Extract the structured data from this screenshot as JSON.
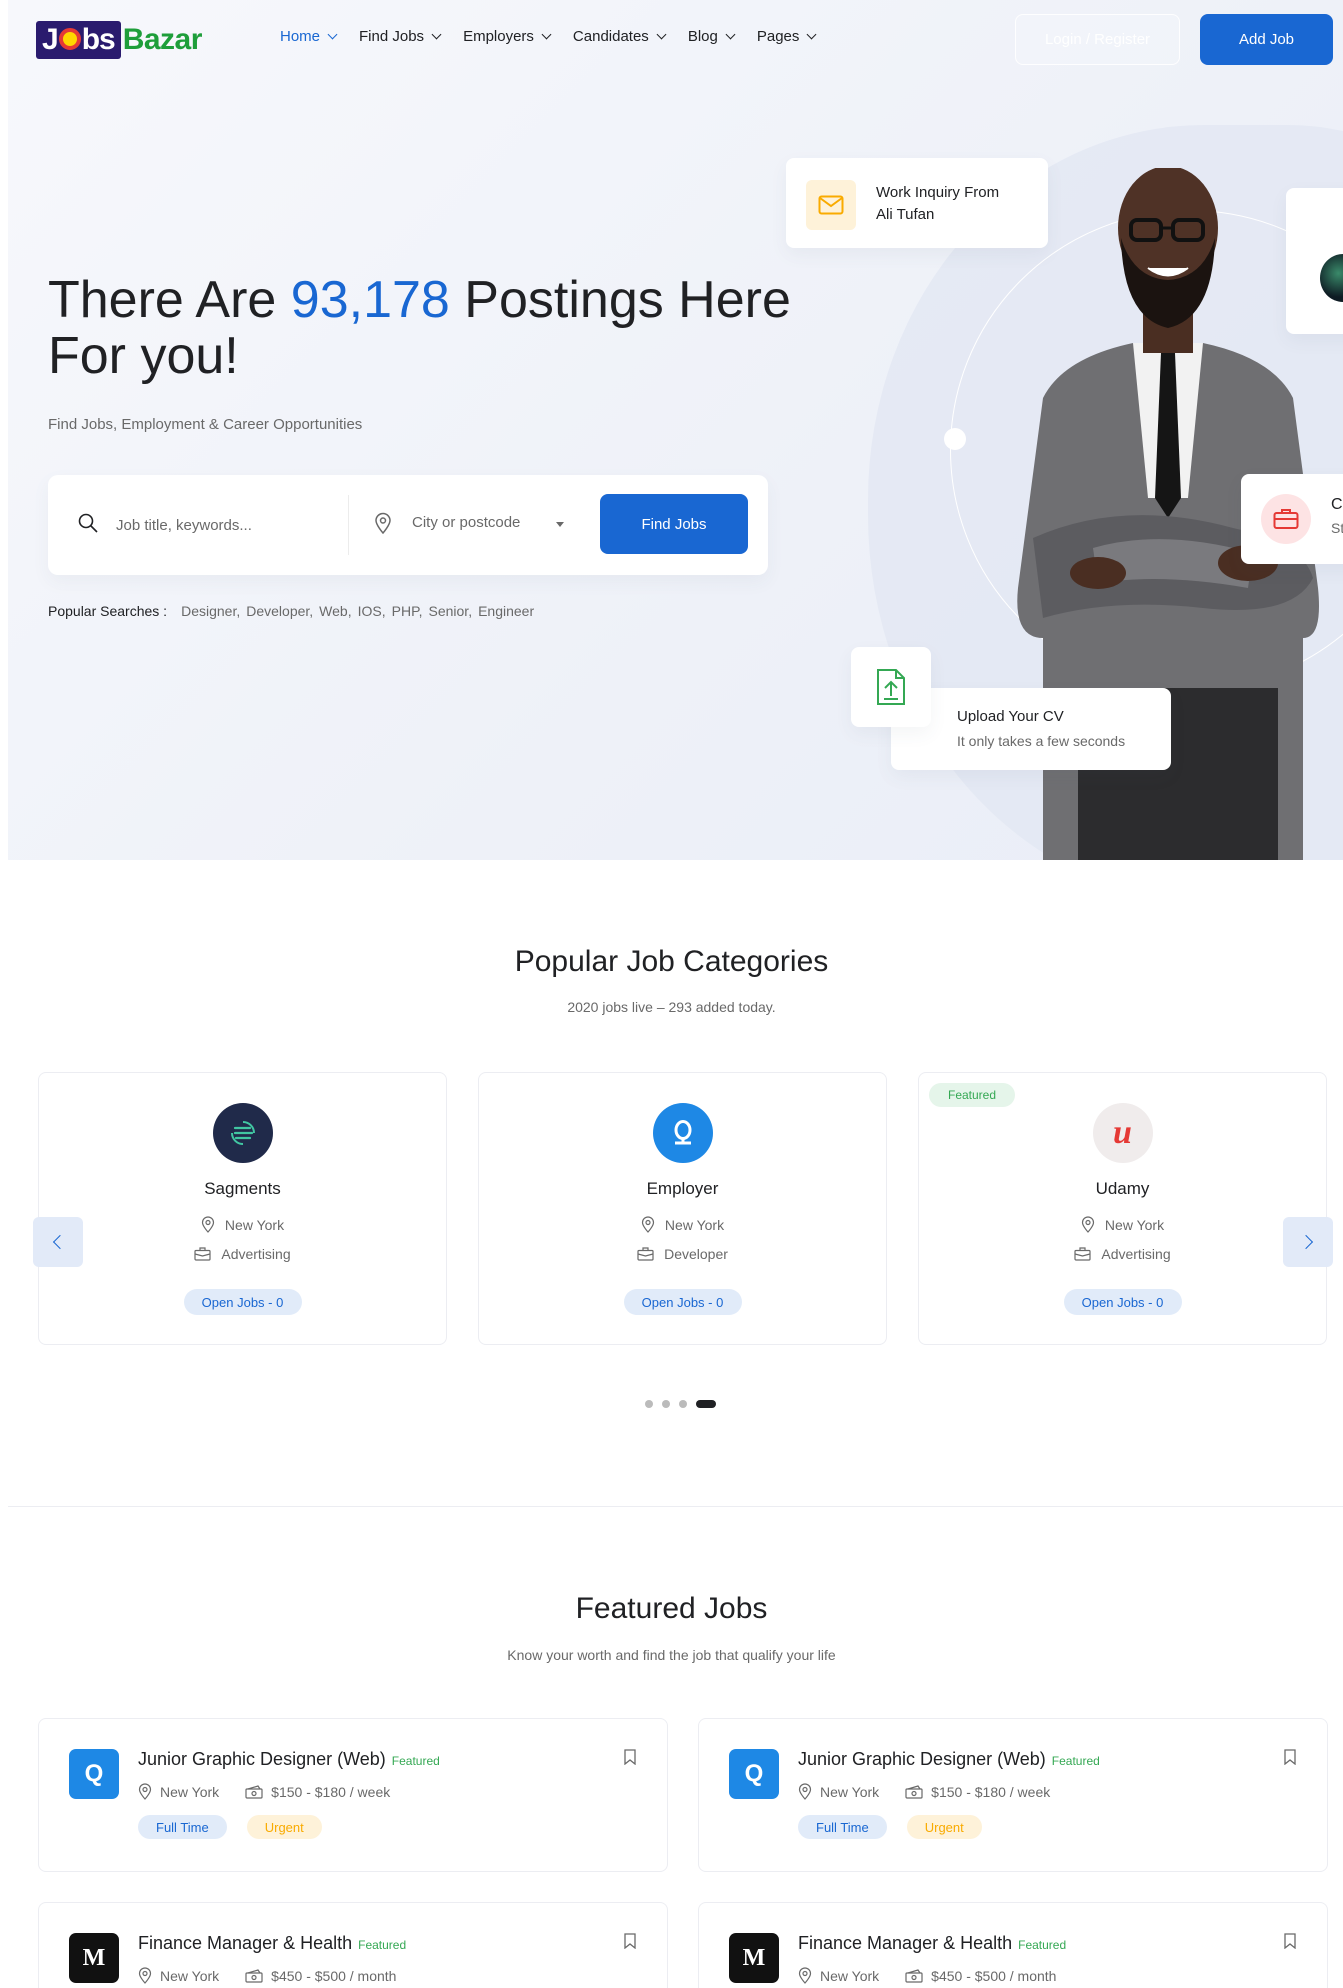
{
  "header": {
    "logo_jobs": "J",
    "logo_bs": "bs",
    "logo_bazar": "Bazar",
    "nav": [
      {
        "label": "Home",
        "active": true
      },
      {
        "label": "Find Jobs",
        "active": false
      },
      {
        "label": "Employers",
        "active": false
      },
      {
        "label": "Candidates",
        "active": false
      },
      {
        "label": "Blog",
        "active": false
      },
      {
        "label": "Pages",
        "active": false
      }
    ],
    "login_label": "Login / Register",
    "add_job_label": "Add Job"
  },
  "hero": {
    "title_pre": "There Are ",
    "title_count": "93,178",
    "title_post": " Postings Here For you!",
    "subtitle": "Find Jobs, Employment & Career Opportunities",
    "search": {
      "keywords_placeholder": "Job title, keywords...",
      "location_placeholder": "City or postcode",
      "button_label": "Find Jobs"
    },
    "popular": {
      "label": "Popular Searches :",
      "tags": [
        "Designer,",
        "Developer,",
        "Web,",
        "IOS,",
        "PHP,",
        "Senior,",
        "Engineer"
      ]
    },
    "inquiry_card": {
      "line1": "Work Inquiry From",
      "line2": "Ali Tufan"
    },
    "right_card": {
      "title": "Cre",
      "subtitle": "Sta"
    },
    "upload_card": {
      "title": "Upload Your CV",
      "subtitle": "It only takes a few seconds"
    }
  },
  "categories": {
    "title": "Popular Job Categories",
    "subtitle": "2020 jobs live – 293 added today.",
    "items": [
      {
        "name": "Sagments",
        "location": "New York",
        "category": "Advertising",
        "open_jobs": "Open Jobs - 0",
        "featured": "",
        "logo_color": "#202a4a"
      },
      {
        "name": "Employer",
        "location": "New York",
        "category": "Developer",
        "open_jobs": "Open Jobs - 0",
        "featured": "",
        "logo_color": "#1e88e5"
      },
      {
        "name": "Udamy",
        "location": "New York",
        "category": "Advertising",
        "open_jobs": "Open Jobs - 0",
        "featured": "Featured",
        "logo_color": "#f0ecec"
      }
    ],
    "pager": {
      "count": 4,
      "active": 3
    }
  },
  "featured_jobs": {
    "title": "Featured Jobs",
    "subtitle": "Know your worth and find the job that qualify your life",
    "items": [
      {
        "title": "Junior Graphic Designer (Web)",
        "featured": "Featured",
        "location": "New York",
        "salary": "$150 - $180 / week",
        "tags": [
          "Full Time",
          "Urgent"
        ],
        "logo_text": "Q",
        "logo_color": "#1e88e5"
      },
      {
        "title": "Junior Graphic Designer (Web)",
        "featured": "Featured",
        "location": "New York",
        "salary": "$150 - $180 / week",
        "tags": [
          "Full Time",
          "Urgent"
        ],
        "logo_text": "Q",
        "logo_color": "#1e88e5"
      },
      {
        "title": "Finance Manager & Health",
        "featured": "Featured",
        "location": "New York",
        "salary": "$450 - $500 / month",
        "tags": [],
        "logo_text": "M",
        "logo_color": "#111111"
      },
      {
        "title": "Finance Manager & Health",
        "featured": "Featured",
        "location": "New York",
        "salary": "$450 - $500 / month",
        "tags": [],
        "logo_text": "M",
        "logo_color": "#111111"
      }
    ]
  },
  "colors": {
    "primary": "#1967d2",
    "green": "#34a853",
    "yellow": "#f9ab00"
  }
}
